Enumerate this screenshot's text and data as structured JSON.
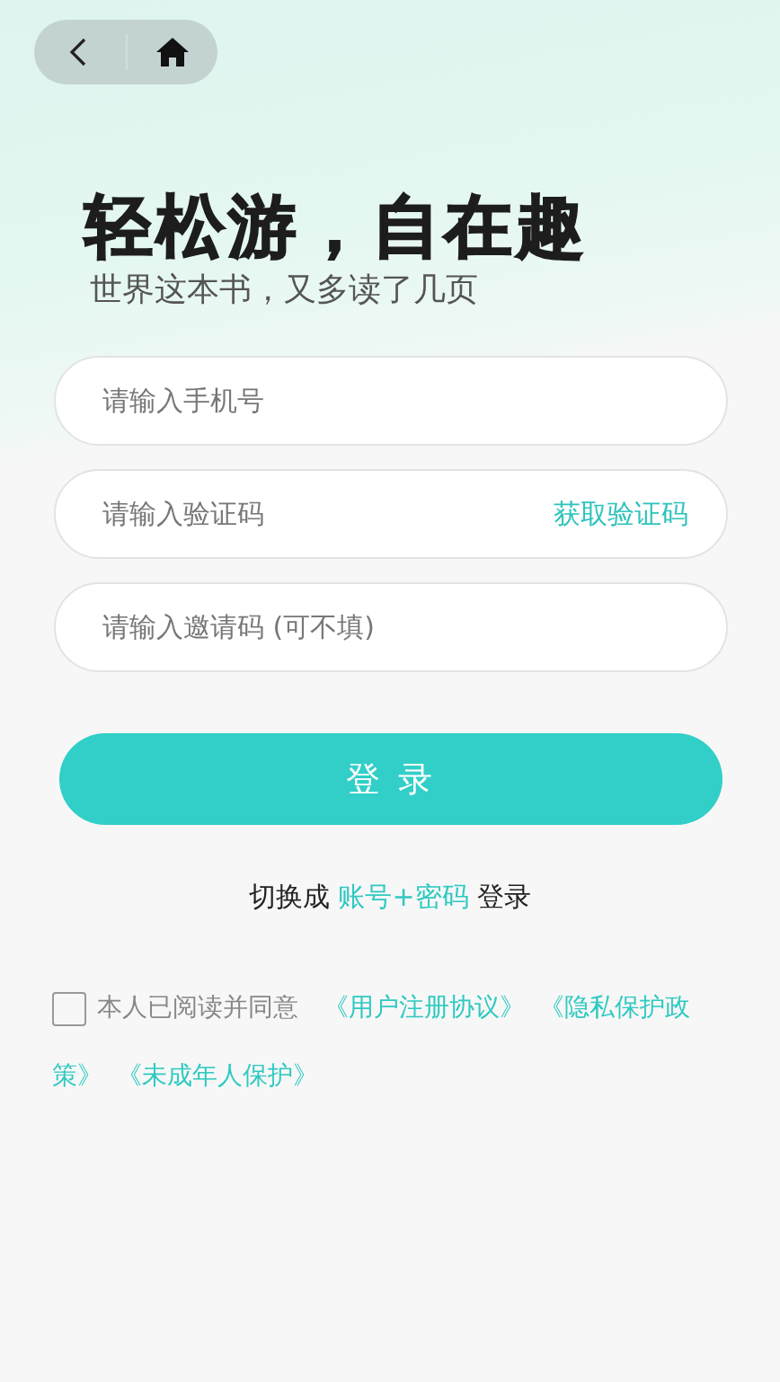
{
  "title": "轻松游，自在趣",
  "subtitle": "世界这本书，又多读了几页",
  "fields": [
    {
      "placeholder": "请输入手机号"
    },
    {
      "placeholder": "请输入验证码",
      "action": "获取验证码"
    },
    {
      "placeholder": "请输入邀请码 (可不填)"
    }
  ],
  "login_button": "登 录",
  "switch": {
    "prefix": "切换成",
    "link": "账号+密码",
    "suffix": "登录"
  },
  "agreement": {
    "checked": false,
    "label": "本人已阅读并同意",
    "links": [
      "《用户注册协议》",
      "《隐私保护政",
      "策》",
      "《未成年人保护》"
    ]
  }
}
